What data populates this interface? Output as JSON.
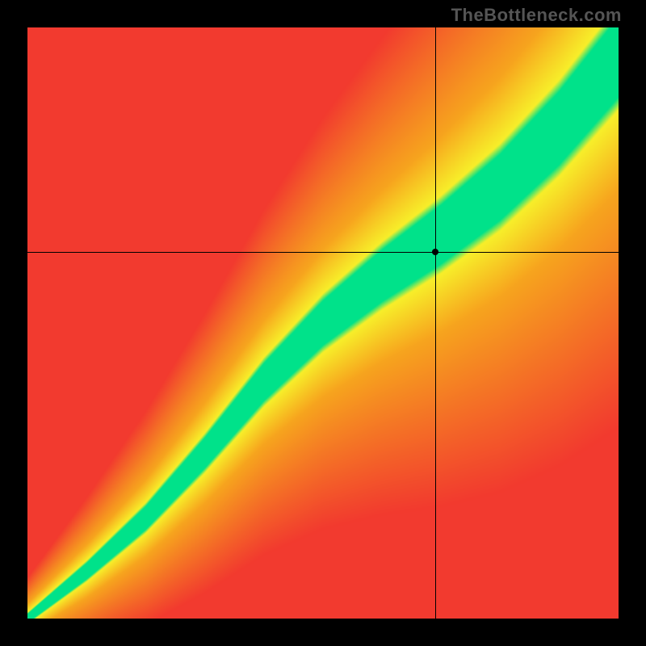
{
  "watermark": "TheBottleneck.com",
  "chart_data": {
    "type": "heatmap",
    "title": "",
    "xlabel": "",
    "ylabel": "",
    "xlim": [
      0,
      100
    ],
    "ylim": [
      0,
      100
    ],
    "crosshair": {
      "x": 69,
      "y": 62
    },
    "marker": {
      "x": 69,
      "y": 62
    },
    "diagonal_band": {
      "description": "Green optimal band along a slightly S-curved diagonal; colors transition green→yellow→orange→red with distance from band.",
      "band_center_points_xy": [
        [
          0,
          0
        ],
        [
          10,
          8
        ],
        [
          20,
          17
        ],
        [
          30,
          28
        ],
        [
          40,
          40
        ],
        [
          50,
          50
        ],
        [
          60,
          58
        ],
        [
          70,
          65
        ],
        [
          80,
          73
        ],
        [
          90,
          83
        ],
        [
          100,
          95
        ]
      ],
      "band_halfwidth_percent_start": 1,
      "band_halfwidth_percent_end": 9
    },
    "color_stops": {
      "optimal": "#00e28a",
      "near": "#f7ef2a",
      "mid": "#f7a51e",
      "far": "#f23a2f"
    }
  }
}
